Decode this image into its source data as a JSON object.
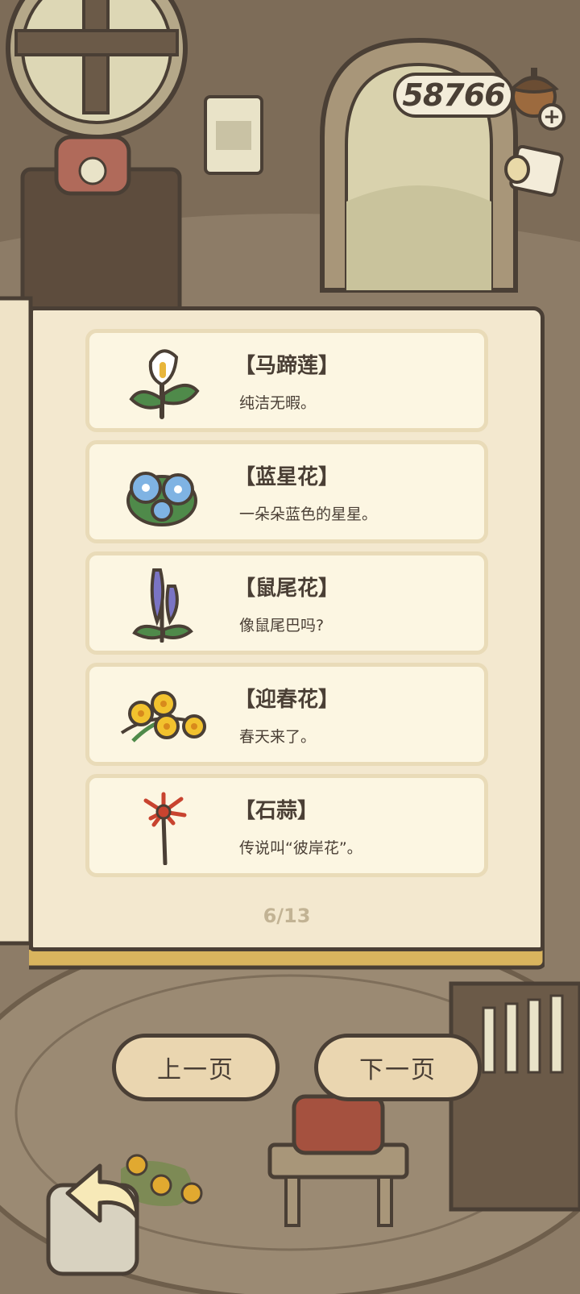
{
  "coins": {
    "value": "58766"
  },
  "entries": [
    {
      "name": "【马蹄莲】",
      "desc": "纯洁无暇。",
      "icon": "calla-lily-icon"
    },
    {
      "name": "【蓝星花】",
      "desc": "一朵朵蓝色的星星。",
      "icon": "blue-star-flower-icon"
    },
    {
      "name": "【鼠尾花】",
      "desc": "像鼠尾巴吗?",
      "icon": "salvia-icon"
    },
    {
      "name": "【迎春花】",
      "desc": "春天来了。",
      "icon": "winter-jasmine-icon"
    },
    {
      "name": "【石蒜】",
      "desc": "传说叫“彼岸花”。",
      "icon": "red-spider-lily-icon"
    }
  ],
  "pagination": {
    "label": "6/13",
    "current": 6,
    "total": 13
  },
  "nav": {
    "prev_label": "上一页",
    "next_label": "下一页"
  },
  "icons": {
    "back": "back-arrow-icon",
    "add_coins": "plus-icon",
    "currency": "acorn-icon"
  },
  "colors": {
    "outline": "#4a3f35",
    "page": "#f3e8cf",
    "card": "#fcf6e2",
    "button": "#ead6b0"
  }
}
